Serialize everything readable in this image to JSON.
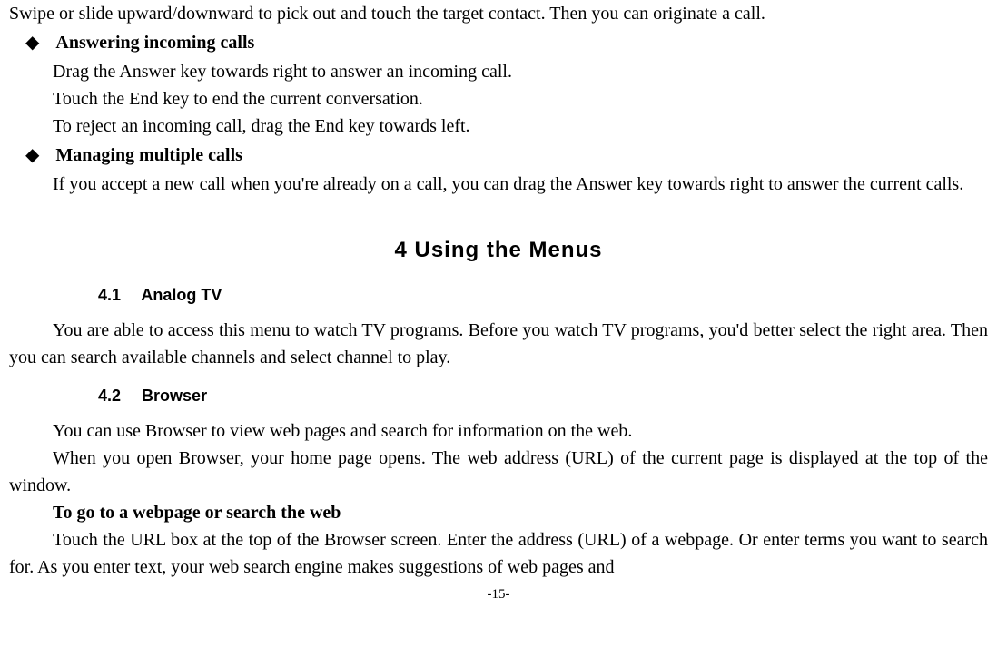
{
  "p1": "Swipe or slide upward/downward to pick out and touch the target contact. Then you can originate a call.",
  "bullet1": {
    "label": "Answering incoming calls",
    "lines": [
      "Drag the Answer key towards right to answer an incoming call.",
      "Touch the End key to end the current conversation.",
      "To reject an incoming call, drag the End key towards left."
    ]
  },
  "bullet2": {
    "label": "Managing multiple calls",
    "p": "If you accept a new call when you're already on a call, you can drag the Answer key towards right to answer the current calls."
  },
  "section": {
    "num": "4",
    "title": "Using the Menus"
  },
  "sub41": {
    "num": "4.1",
    "title": "Analog TV",
    "p": "You are able to access this menu to watch TV programs. Before you watch TV programs, you'd better select the right area. Then you can search available channels and select channel to play."
  },
  "sub42": {
    "num": "4.2",
    "title": "Browser",
    "p1": "You can use Browser to view web pages and search for information on the web.",
    "p2": "When you open Browser, your home page opens. The web address (URL) of the current page is displayed at the top of the window.",
    "h": "To go to a webpage or search the web",
    "p3": "Touch the URL box at the top of the Browser screen. Enter the address (URL) of a webpage. Or enter terms you want to search for. As you enter text, your web search engine makes suggestions of web pages and"
  },
  "page_num": "-15-"
}
